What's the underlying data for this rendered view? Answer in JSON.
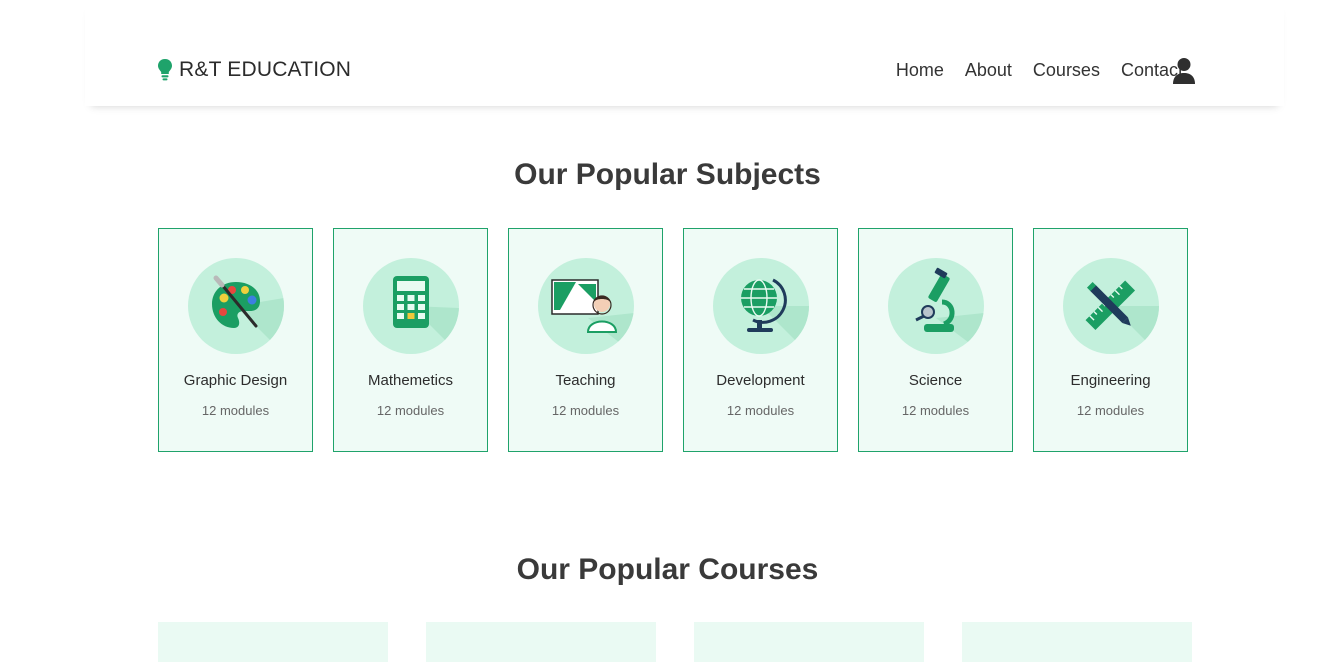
{
  "header": {
    "brand": "R&T EDUCATION",
    "nav": [
      "Home",
      "About",
      "Courses",
      "Contact"
    ]
  },
  "subjects": {
    "title": "Our Popular Subjects",
    "items": [
      {
        "name": "Graphic Design",
        "modules": "12 modules",
        "icon": "palette-icon"
      },
      {
        "name": "Mathemetics",
        "modules": "12 modules",
        "icon": "calculator-icon"
      },
      {
        "name": "Teaching",
        "modules": "12 modules",
        "icon": "teacher-board-icon"
      },
      {
        "name": "Development",
        "modules": "12 modules",
        "icon": "globe-icon"
      },
      {
        "name": "Science",
        "modules": "12 modules",
        "icon": "microscope-icon"
      },
      {
        "name": "Engineering",
        "modules": "12 modules",
        "icon": "ruler-pencil-icon"
      }
    ]
  },
  "courses": {
    "title": "Our Popular Courses"
  },
  "colors": {
    "accent": "#1fa36b",
    "card_bg": "#effbf6",
    "icon_circle": "#c3f0dc"
  }
}
